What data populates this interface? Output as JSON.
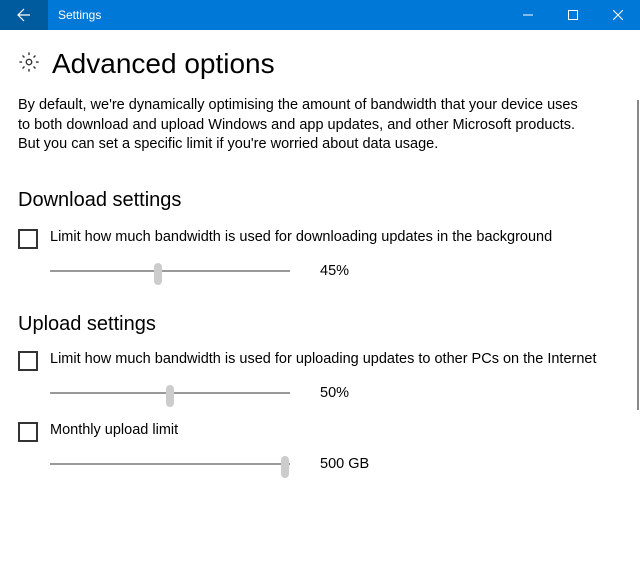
{
  "window": {
    "title": "Settings"
  },
  "page": {
    "title": "Advanced options",
    "description": "By default, we're dynamically optimising the amount of bandwidth that your device uses to both download and upload Windows and app updates, and other Microsoft products. But you can set a specific limit if you're worried about data usage."
  },
  "download_section": {
    "heading": "Download settings",
    "checkbox_label": "Limit how much bandwidth is used for downloading updates in the background",
    "slider_value": "45%",
    "slider_pct": 45
  },
  "upload_section": {
    "heading": "Upload settings",
    "checkbox_label": "Limit how much bandwidth is used for uploading updates to other PCs on the Internet",
    "slider_value": "50%",
    "slider_pct": 50,
    "monthly_limit_label": "Monthly upload limit",
    "monthly_limit_value": "500 GB",
    "monthly_limit_pct": 98
  },
  "colors": {
    "accent": "#0078d7",
    "accent_dark": "#005a9e"
  }
}
